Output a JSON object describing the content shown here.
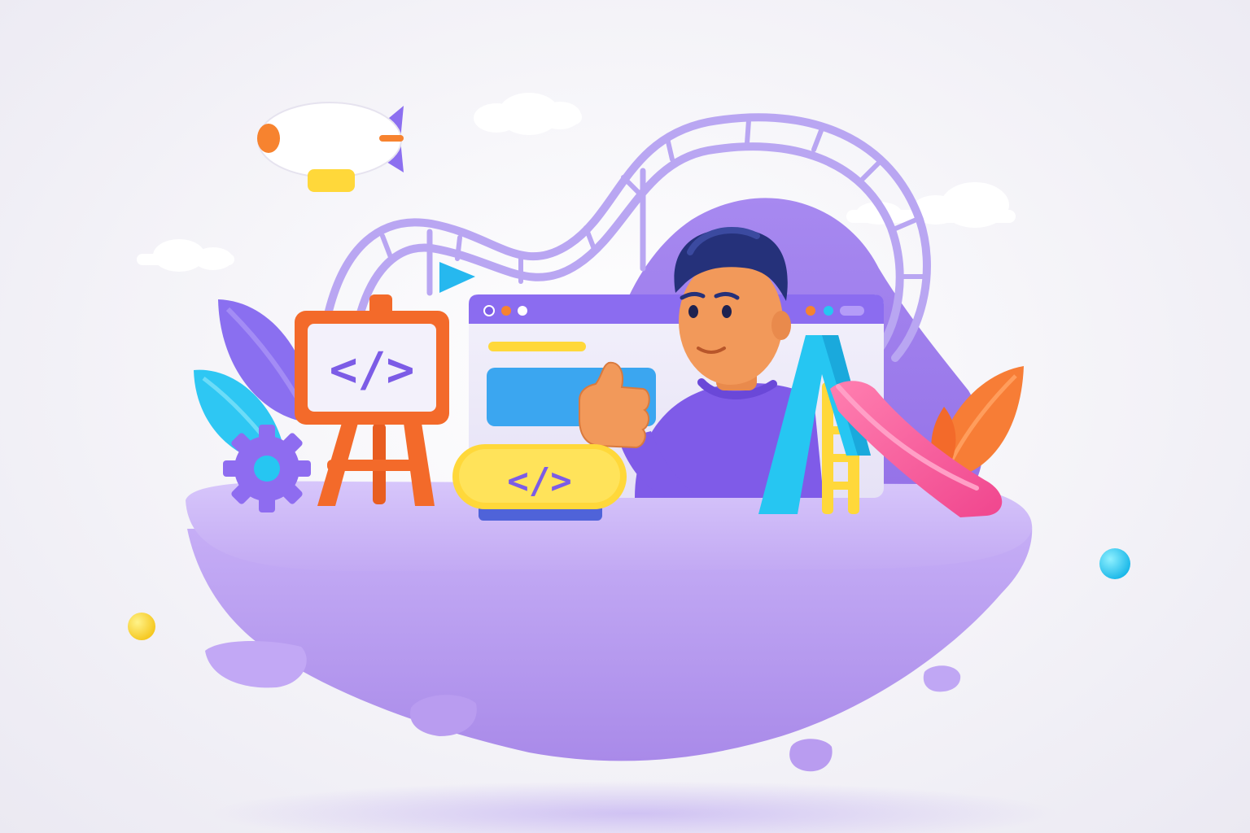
{
  "easel_board": {
    "code_text": "</>"
  },
  "code_badge": {
    "code_text": "</>"
  },
  "colors": {
    "background": "#f3f2f7",
    "island_top": "#c9b4f4",
    "island_body": "#b89bef",
    "purple_accent": "#7c5ce6",
    "orange_accent": "#f36a2a",
    "cyan_accent": "#26c6f2",
    "yellow_accent": "#ffd83a",
    "pink_accent": "#f2559b",
    "skin": "#f2995a",
    "hair": "#25317a"
  },
  "icons": [
    "blimp-icon",
    "cloud-icon",
    "roller-coaster-track-icon",
    "flag-icon",
    "leaf-icon",
    "gear-icon",
    "easel-icon",
    "browser-window-icon",
    "code-badge-icon",
    "developer-character",
    "thumbs-up-icon",
    "slide-icon",
    "floating-island",
    "sphere-icon",
    "rock-icon"
  ]
}
